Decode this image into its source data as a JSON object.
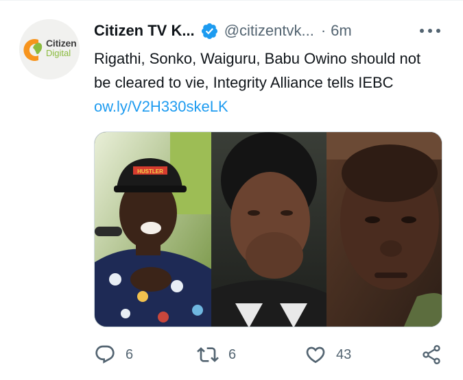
{
  "tweet": {
    "author_name": "Citizen TV K...",
    "author_handle": "@citizentvk...",
    "separator": "·",
    "time": "6m",
    "text_prefix": "Rigathi, Sonko, Waiguru, Babu Owino should not be cleared to vie, Integrity Alliance tells IEBC ",
    "link_text": "ow.ly/V2H330skeLK",
    "verified": true
  },
  "avatar_logo": {
    "line1": "Citizen",
    "line2": "Digital",
    "colors": {
      "orange": "#f7941d",
      "green": "#8bbb3f",
      "text": "#3c3c3c"
    }
  },
  "media": {
    "description_icons": [
      "photo-left",
      "photo-middle",
      "photo-right"
    ],
    "cap_text": "HUSTLER"
  },
  "actions": {
    "reply_count": "6",
    "retweet_count": "6",
    "like_count": "43"
  },
  "colors": {
    "accent": "#1d9bf0",
    "secondary_text": "#536471",
    "primary_text": "#0f1419"
  }
}
